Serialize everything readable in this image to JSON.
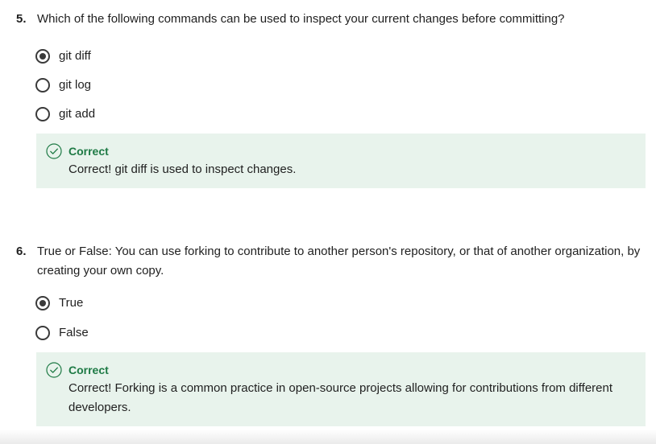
{
  "questions": [
    {
      "number": "5.",
      "text": "Which of the following commands can be used to inspect your current changes before committing?",
      "options": [
        {
          "label": "git diff",
          "selected": true
        },
        {
          "label": "git log",
          "selected": false
        },
        {
          "label": "git add",
          "selected": false
        }
      ],
      "feedback": {
        "status": "Correct",
        "message": "Correct! git diff is used to inspect changes."
      }
    },
    {
      "number": "6.",
      "text": "True or False: You can use forking to contribute to another person's repository, or that of another organization, by creating your own copy.",
      "options": [
        {
          "label": "True",
          "selected": true
        },
        {
          "label": "False",
          "selected": false
        }
      ],
      "feedback": {
        "status": "Correct",
        "message": "Correct! Forking is a common practice in open-source projects allowing for contributions from different developers."
      }
    }
  ],
  "colors": {
    "feedback_bg": "#e8f3ec",
    "correct_green": "#1e7a45",
    "radio": "#3a3a3a"
  },
  "icons": {
    "feedback": "check-circle-icon"
  }
}
